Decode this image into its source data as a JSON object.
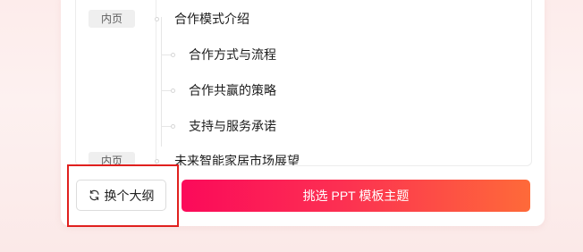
{
  "outline": {
    "sections": [
      {
        "tag": "内页",
        "title": "合作模式介绍",
        "children": [
          "合作方式与流程",
          "合作共赢的策略",
          "支持与服务承诺"
        ]
      },
      {
        "tag": "内页",
        "title": "未来智能家居市场展望",
        "children": []
      }
    ]
  },
  "actions": {
    "change_outline_label": "换个大纲",
    "change_outline_icon": "refresh-icon",
    "choose_theme_label": "挑选 PPT 模板主题"
  },
  "colors": {
    "primary_gradient_start": "#fb0a5a",
    "primary_gradient_end": "#fe6a39",
    "highlight_border": "#e0201e"
  }
}
